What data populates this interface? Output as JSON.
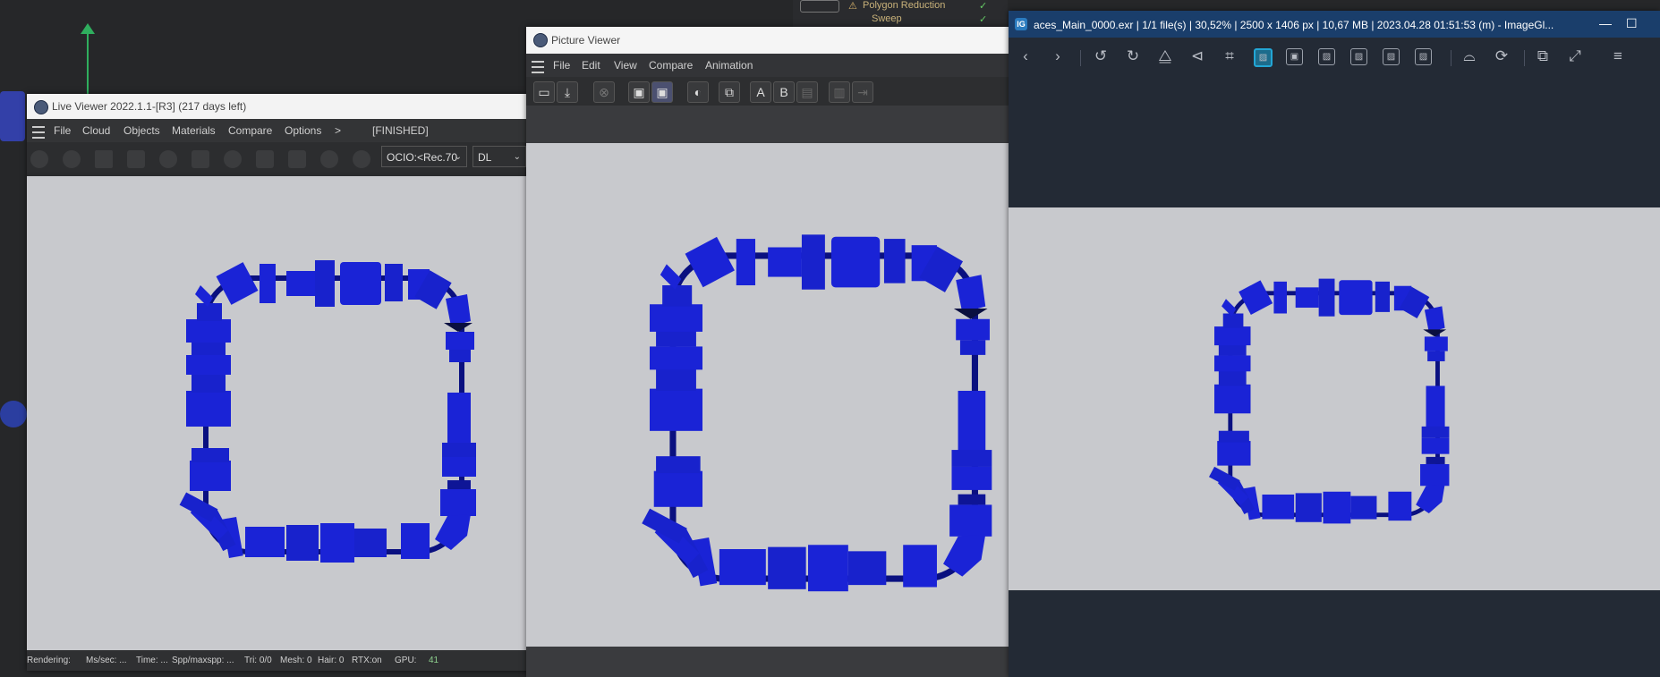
{
  "background": {
    "object_items": [
      "Polygon Reduction",
      "Sweep"
    ]
  },
  "live_viewer": {
    "title": "Live Viewer 2022.1.1-[R3] (217 days left)",
    "menu": [
      "File",
      "Cloud",
      "Objects",
      "Materials",
      "Compare",
      "Options",
      ">"
    ],
    "status_badge": "[FINISHED]",
    "ocio": "OCIO:<Rec.70",
    "mode": "DL",
    "statusbar": {
      "rendering": "Rendering:",
      "mssec": "Ms/sec: ...",
      "time": "Time: ...",
      "spp": "Spp/maxspp: ...",
      "tri": "Tri: 0/0",
      "mesh": "Mesh: 0",
      "hair": "Hair: 0",
      "rtx": "RTX:on",
      "gpu": "GPU:",
      "gpu_value": "41"
    }
  },
  "picture_viewer": {
    "title": "Picture Viewer",
    "menu": [
      "File",
      "Edit",
      "View",
      "Compare",
      "Animation"
    ],
    "tool_labels": [
      "A",
      "B"
    ]
  },
  "imageglass": {
    "title": "aces_Main_0000.exr  |  1/1 file(s)  |  30,52%  |  2500 x 1406 px  |  10,67 MB  |  2023.04.28 01:51:53 (m)  - ImageGl...",
    "minimize": "—",
    "maximize": "☐"
  },
  "colors": {
    "object_blue": "#1a23d6",
    "object_blue_dark": "#0e1596",
    "canvas_grey": "#c8c9cd",
    "imageglass_bg": "#232a35",
    "imageglass_title": "#1a3e6b",
    "active_tool": "#23a6d5"
  }
}
